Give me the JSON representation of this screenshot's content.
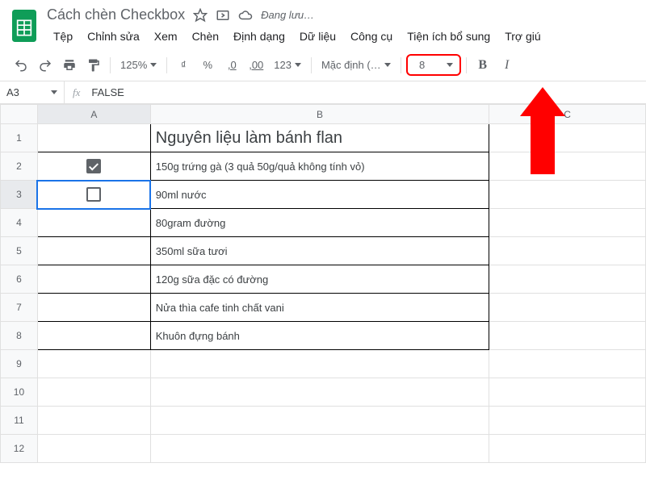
{
  "doc": {
    "title": "Cách chèn Checkbox",
    "saving": "Đang lưu…"
  },
  "menu": {
    "file": "Tệp",
    "edit": "Chỉnh sửa",
    "view": "Xem",
    "insert": "Chèn",
    "format": "Định dạng",
    "data": "Dữ liệu",
    "tools": "Công cụ",
    "addons": "Tiện ích bổ sung",
    "help": "Trợ giú"
  },
  "toolbar": {
    "zoom": "125%",
    "currency": "₫",
    "percent": "%",
    "dec_dec": ",0",
    "inc_dec": ",00",
    "num_fmt": "123",
    "font": "Mặc định (…",
    "font_size": "8",
    "bold": "B",
    "italic": "I"
  },
  "cell_ref": {
    "name": "A3",
    "fx": "fx",
    "value": "FALSE"
  },
  "columns": {
    "A": "A",
    "B": "B",
    "C": "C"
  },
  "rows": [
    "1",
    "2",
    "3",
    "4",
    "5",
    "6",
    "7",
    "8",
    "9",
    "10",
    "11",
    "12"
  ],
  "sheet": {
    "b1": "Nguyên liệu làm bánh flan",
    "a2_checked": true,
    "a3_checked": false,
    "b2": "150g trứng gà (3 quả 50g/quả không tính vỏ)",
    "b3": "90ml nước",
    "b4": "80gram đường",
    "b5": "350ml sữa tươi",
    "b6": "120g sữa đặc có đường",
    "b7": "Nửa thìa cafe tinh chất vani",
    "b8": "Khuôn đựng bánh"
  }
}
